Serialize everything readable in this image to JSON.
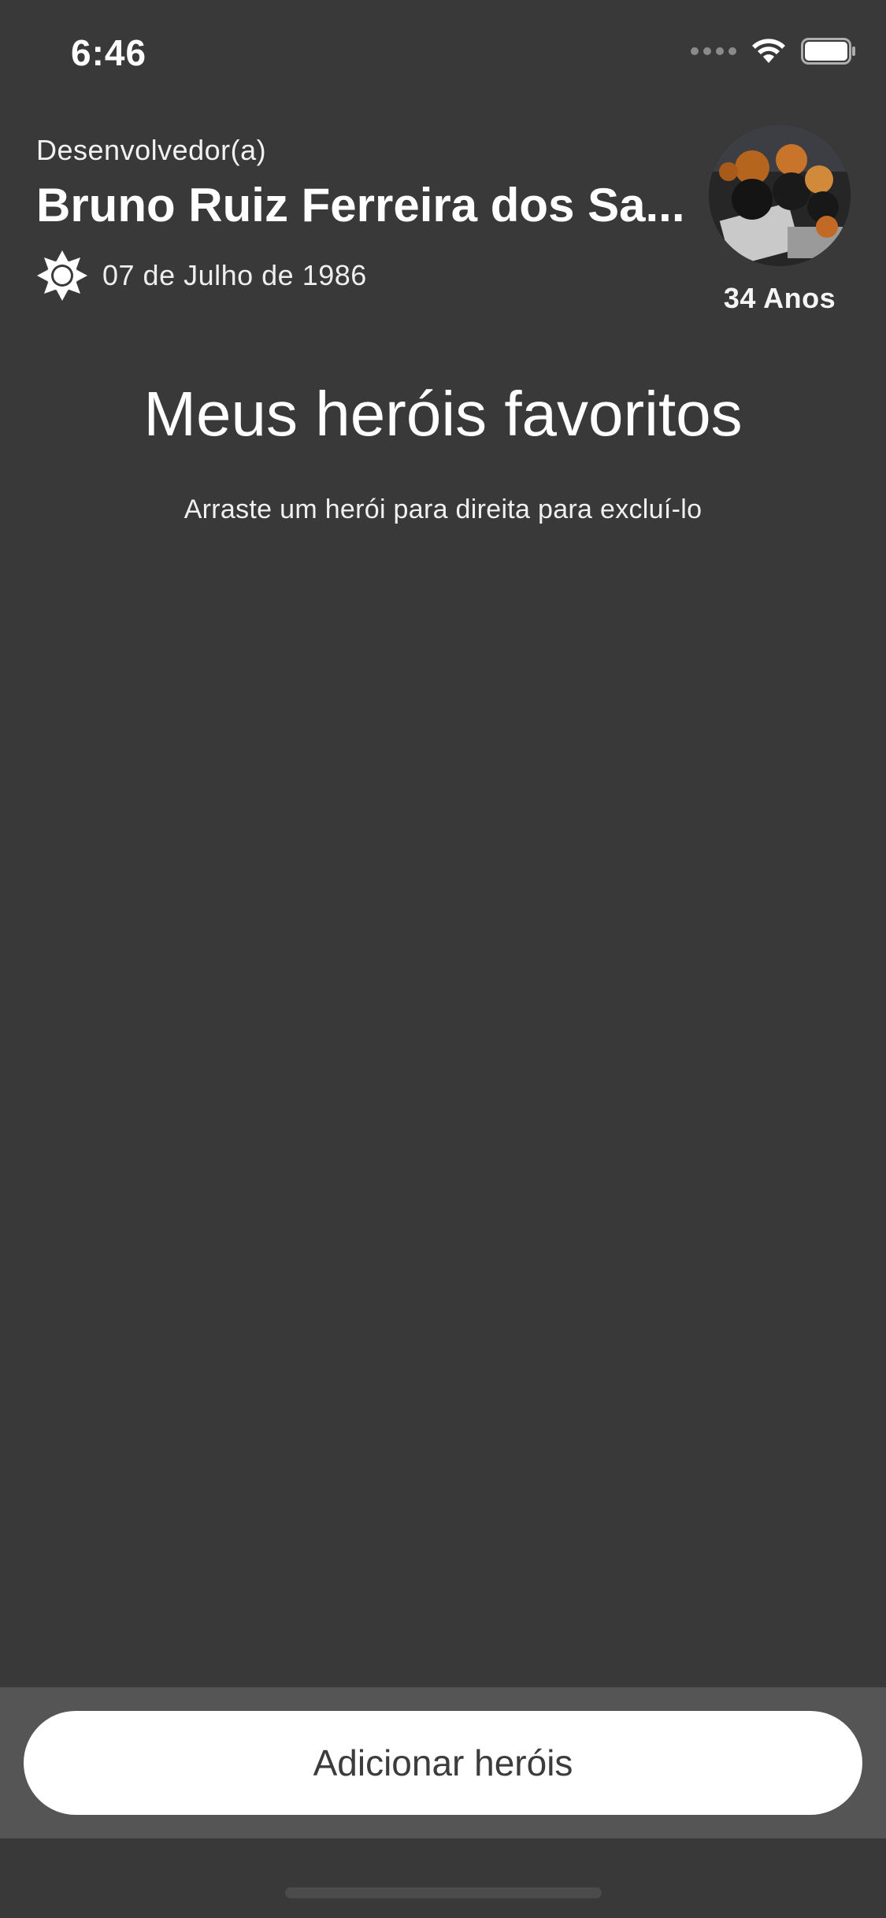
{
  "status_bar": {
    "time": "6:46",
    "icons": [
      "cellular-signal-icon",
      "wifi-icon",
      "battery-icon"
    ]
  },
  "profile": {
    "role": "Desenvolvedor(a)",
    "name": "Bruno Ruiz Ferreira dos Sa...",
    "birth_date": "07 de Julho de 1986",
    "zodiac_icon": "sun-icon",
    "age": "34 Anos",
    "avatar": "avatar-photo"
  },
  "main": {
    "title": "Meus heróis favoritos",
    "subtitle": "Arraste um herói para direita para excluí-lo"
  },
  "footer": {
    "add_button_label": "Adicionar heróis"
  },
  "colors": {
    "background": "#393939",
    "footer_panel": "#555555",
    "button": "#ffffff",
    "button_text": "#3c3c3c"
  }
}
